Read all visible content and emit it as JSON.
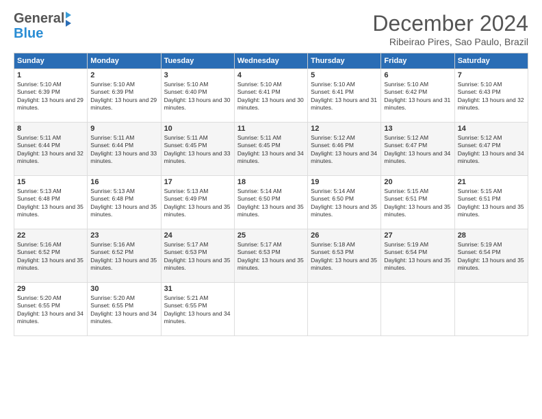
{
  "header": {
    "logo_general": "General",
    "logo_blue": "Blue",
    "title": "December 2024",
    "subtitle": "Ribeirao Pires, Sao Paulo, Brazil"
  },
  "days_of_week": [
    "Sunday",
    "Monday",
    "Tuesday",
    "Wednesday",
    "Thursday",
    "Friday",
    "Saturday"
  ],
  "weeks": [
    [
      {
        "day": "1",
        "sunrise": "5:10 AM",
        "sunset": "6:39 PM",
        "daylight": "13 hours and 29 minutes."
      },
      {
        "day": "2",
        "sunrise": "5:10 AM",
        "sunset": "6:39 PM",
        "daylight": "13 hours and 29 minutes."
      },
      {
        "day": "3",
        "sunrise": "5:10 AM",
        "sunset": "6:40 PM",
        "daylight": "13 hours and 30 minutes."
      },
      {
        "day": "4",
        "sunrise": "5:10 AM",
        "sunset": "6:41 PM",
        "daylight": "13 hours and 30 minutes."
      },
      {
        "day": "5",
        "sunrise": "5:10 AM",
        "sunset": "6:41 PM",
        "daylight": "13 hours and 31 minutes."
      },
      {
        "day": "6",
        "sunrise": "5:10 AM",
        "sunset": "6:42 PM",
        "daylight": "13 hours and 31 minutes."
      },
      {
        "day": "7",
        "sunrise": "5:10 AM",
        "sunset": "6:43 PM",
        "daylight": "13 hours and 32 minutes."
      }
    ],
    [
      {
        "day": "8",
        "sunrise": "5:11 AM",
        "sunset": "6:44 PM",
        "daylight": "13 hours and 32 minutes."
      },
      {
        "day": "9",
        "sunrise": "5:11 AM",
        "sunset": "6:44 PM",
        "daylight": "13 hours and 33 minutes."
      },
      {
        "day": "10",
        "sunrise": "5:11 AM",
        "sunset": "6:45 PM",
        "daylight": "13 hours and 33 minutes."
      },
      {
        "day": "11",
        "sunrise": "5:11 AM",
        "sunset": "6:45 PM",
        "daylight": "13 hours and 34 minutes."
      },
      {
        "day": "12",
        "sunrise": "5:12 AM",
        "sunset": "6:46 PM",
        "daylight": "13 hours and 34 minutes."
      },
      {
        "day": "13",
        "sunrise": "5:12 AM",
        "sunset": "6:47 PM",
        "daylight": "13 hours and 34 minutes."
      },
      {
        "day": "14",
        "sunrise": "5:12 AM",
        "sunset": "6:47 PM",
        "daylight": "13 hours and 34 minutes."
      }
    ],
    [
      {
        "day": "15",
        "sunrise": "5:13 AM",
        "sunset": "6:48 PM",
        "daylight": "13 hours and 35 minutes."
      },
      {
        "day": "16",
        "sunrise": "5:13 AM",
        "sunset": "6:48 PM",
        "daylight": "13 hours and 35 minutes."
      },
      {
        "day": "17",
        "sunrise": "5:13 AM",
        "sunset": "6:49 PM",
        "daylight": "13 hours and 35 minutes."
      },
      {
        "day": "18",
        "sunrise": "5:14 AM",
        "sunset": "6:50 PM",
        "daylight": "13 hours and 35 minutes."
      },
      {
        "day": "19",
        "sunrise": "5:14 AM",
        "sunset": "6:50 PM",
        "daylight": "13 hours and 35 minutes."
      },
      {
        "day": "20",
        "sunrise": "5:15 AM",
        "sunset": "6:51 PM",
        "daylight": "13 hours and 35 minutes."
      },
      {
        "day": "21",
        "sunrise": "5:15 AM",
        "sunset": "6:51 PM",
        "daylight": "13 hours and 35 minutes."
      }
    ],
    [
      {
        "day": "22",
        "sunrise": "5:16 AM",
        "sunset": "6:52 PM",
        "daylight": "13 hours and 35 minutes."
      },
      {
        "day": "23",
        "sunrise": "5:16 AM",
        "sunset": "6:52 PM",
        "daylight": "13 hours and 35 minutes."
      },
      {
        "day": "24",
        "sunrise": "5:17 AM",
        "sunset": "6:53 PM",
        "daylight": "13 hours and 35 minutes."
      },
      {
        "day": "25",
        "sunrise": "5:17 AM",
        "sunset": "6:53 PM",
        "daylight": "13 hours and 35 minutes."
      },
      {
        "day": "26",
        "sunrise": "5:18 AM",
        "sunset": "6:53 PM",
        "daylight": "13 hours and 35 minutes."
      },
      {
        "day": "27",
        "sunrise": "5:19 AM",
        "sunset": "6:54 PM",
        "daylight": "13 hours and 35 minutes."
      },
      {
        "day": "28",
        "sunrise": "5:19 AM",
        "sunset": "6:54 PM",
        "daylight": "13 hours and 35 minutes."
      }
    ],
    [
      {
        "day": "29",
        "sunrise": "5:20 AM",
        "sunset": "6:55 PM",
        "daylight": "13 hours and 34 minutes."
      },
      {
        "day": "30",
        "sunrise": "5:20 AM",
        "sunset": "6:55 PM",
        "daylight": "13 hours and 34 minutes."
      },
      {
        "day": "31",
        "sunrise": "5:21 AM",
        "sunset": "6:55 PM",
        "daylight": "13 hours and 34 minutes."
      },
      {
        "day": "",
        "sunrise": "",
        "sunset": "",
        "daylight": ""
      },
      {
        "day": "",
        "sunrise": "",
        "sunset": "",
        "daylight": ""
      },
      {
        "day": "",
        "sunrise": "",
        "sunset": "",
        "daylight": ""
      },
      {
        "day": "",
        "sunrise": "",
        "sunset": "",
        "daylight": ""
      }
    ]
  ]
}
